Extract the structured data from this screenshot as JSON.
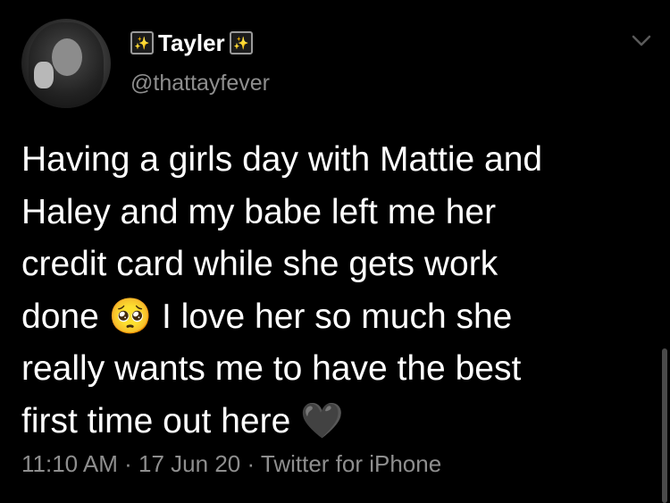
{
  "tweet": {
    "author": {
      "display_name": "Tayler",
      "name_decoration_left": "✨",
      "name_decoration_right": "✨",
      "handle": "@thattayfever"
    },
    "menu_icon": "chevron-down-icon",
    "text": "Having a girls day with Mattie and\nHaley and my babe left me her\ncredit card while she gets work\ndone 🥺 I love her so much she\nreally wants me to have the best\nfirst time out here 🖤",
    "meta": "11:10 AM · 17 Jun 20 · Twitter for iPhone"
  },
  "colors": {
    "background": "#000000",
    "text": "#ffffff",
    "secondary_text": "#8e8e8e"
  }
}
